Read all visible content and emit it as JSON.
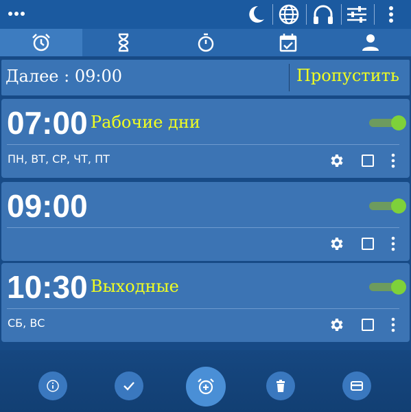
{
  "statusbar": {
    "icons": [
      "more-horizontal-icon",
      "moon-icon",
      "globe-icon",
      "headphones-icon",
      "equalizer-icon",
      "more-vertical-icon"
    ]
  },
  "tabs": [
    {
      "icon": "alarm-clock-icon",
      "active": true
    },
    {
      "icon": "hourglass-icon",
      "active": false
    },
    {
      "icon": "stopwatch-icon",
      "active": false
    },
    {
      "icon": "calendar-check-icon",
      "active": false
    },
    {
      "icon": "person-icon",
      "active": false
    }
  ],
  "next_alarm": {
    "label": "Далее : 09:00",
    "skip_label": "Пропустить"
  },
  "alarms": [
    {
      "time": "07:00",
      "name": "Рабочие дни",
      "days": "ПН, ВТ, СР, ЧТ, ПТ",
      "enabled": true
    },
    {
      "time": "09:00",
      "name": "",
      "days": "",
      "enabled": true
    },
    {
      "time": "10:30",
      "name": "Выходные",
      "days": "СБ, ВС",
      "enabled": true
    }
  ],
  "bottom_actions": [
    "info-icon",
    "check-icon",
    "add-alarm-icon",
    "trash-icon",
    "card-icon"
  ],
  "colors": {
    "background": "#174a86",
    "card": "#3c74b4",
    "accent_text": "#f2ff20",
    "toggle_on": "#7ed13a"
  }
}
